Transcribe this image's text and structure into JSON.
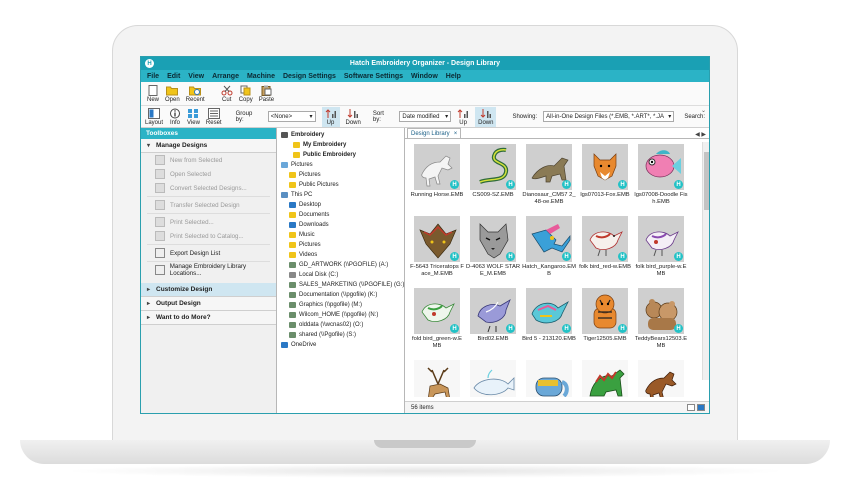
{
  "window": {
    "title": "Hatch Embroidery Organizer - Design Library",
    "app_icon": "H"
  },
  "menu": [
    "File",
    "Edit",
    "View",
    "Arrange",
    "Machine",
    "Design Settings",
    "Software Settings",
    "Window",
    "Help"
  ],
  "toolbar1": [
    {
      "name": "new-button",
      "label": "New",
      "icon": "new-doc-icon"
    },
    {
      "name": "open-button",
      "label": "Open",
      "icon": "folder-open-icon"
    },
    {
      "name": "recent-button",
      "label": "Recent",
      "icon": "recent-folder-icon"
    },
    {
      "name": "cut-button",
      "label": "Cut",
      "icon": "scissors-icon"
    },
    {
      "name": "copy-button",
      "label": "Copy",
      "icon": "copy-icon"
    },
    {
      "name": "paste-button",
      "label": "Paste",
      "icon": "paste-icon"
    }
  ],
  "toolbar2": {
    "layout": "Layout",
    "info": "Info",
    "view": "View",
    "reset": "Reset",
    "group_by_label": "Group by:",
    "group_by_value": "<None>",
    "up1": "Up",
    "down1": "Down",
    "sort_by_label": "Sort by:",
    "sort_by_value": "Date modified",
    "up2": "Up",
    "down2": "Down",
    "showing_label": "Showing:",
    "showing_value": "All-in-One Design Files (*.EMB, *.ART*, *.JA",
    "search_label": "Search:"
  },
  "toolbox": {
    "title": "Toolboxes",
    "manage": "Manage Designs",
    "items": [
      {
        "label": "New from Selected",
        "enabled": false
      },
      {
        "label": "Open Selected",
        "enabled": false
      },
      {
        "label": "Convert Selected Designs...",
        "enabled": false
      },
      {
        "label": "Transfer Selected Design",
        "enabled": false
      },
      {
        "label": "Print Selected...",
        "enabled": false
      },
      {
        "label": "Print Selected to Catalog...",
        "enabled": false
      },
      {
        "label": "Export Design List",
        "enabled": true
      },
      {
        "label": "Manage Embroidery Library Locations...",
        "enabled": true
      }
    ],
    "sections": [
      "Customize Design",
      "Output Design",
      "Want to do More?"
    ]
  },
  "tree": [
    {
      "label": "Embroidery",
      "level": 0,
      "bold": true,
      "color": "#555"
    },
    {
      "label": "My Embroidery",
      "level": 1,
      "bold": true,
      "color": "#f0c419"
    },
    {
      "label": "Public Embroidery",
      "level": 1,
      "bold": true,
      "color": "#f0c419"
    },
    {
      "label": "Pictures",
      "level": 0,
      "bold": false,
      "color": "#6aa7d9"
    },
    {
      "label": "Pictures",
      "level": 1,
      "bold": false,
      "color": "#f0c419"
    },
    {
      "label": "Public Pictures",
      "level": 1,
      "bold": false,
      "color": "#f0c419"
    },
    {
      "label": "This PC",
      "level": 0,
      "bold": false,
      "color": "#5a8fc2"
    },
    {
      "label": "Desktop",
      "level": 1,
      "bold": false,
      "color": "#2a78c5"
    },
    {
      "label": "Documents",
      "level": 1,
      "bold": false,
      "color": "#f0c419"
    },
    {
      "label": "Downloads",
      "level": 1,
      "bold": false,
      "color": "#2a78c5"
    },
    {
      "label": "Music",
      "level": 1,
      "bold": false,
      "color": "#f0c419"
    },
    {
      "label": "Pictures",
      "level": 1,
      "bold": false,
      "color": "#f0c419"
    },
    {
      "label": "Videos",
      "level": 1,
      "bold": false,
      "color": "#f0c419"
    },
    {
      "label": "GD_ARTWORK (\\\\PGOFILE) (A:)",
      "level": 1,
      "bold": false,
      "color": "#6b8e6b"
    },
    {
      "label": "Local Disk (C:)",
      "level": 1,
      "bold": false,
      "color": "#888"
    },
    {
      "label": "SALES_MARKETING (\\\\PGOFILE) (G:)",
      "level": 1,
      "bold": false,
      "color": "#6b8e6b"
    },
    {
      "label": "Documentation (\\\\pgofile) (K:)",
      "level": 1,
      "bold": false,
      "color": "#6b8e6b"
    },
    {
      "label": "Graphics (\\\\pgofile) (M:)",
      "level": 1,
      "bold": false,
      "color": "#6b8e6b"
    },
    {
      "label": "Wilcom_HOME (\\\\pgofile) (N:)",
      "level": 1,
      "bold": false,
      "color": "#6b8e6b"
    },
    {
      "label": "olddata (\\\\wcnas02) (O:)",
      "level": 1,
      "bold": false,
      "color": "#6b8e6b"
    },
    {
      "label": "shared (\\\\Pgofile) (S:)",
      "level": 1,
      "bold": false,
      "color": "#6b8e6b"
    },
    {
      "label": "OneDrive",
      "level": 0,
      "bold": false,
      "color": "#2a78c5"
    }
  ],
  "gallery": {
    "tab": "Design Library",
    "tab_close": "×",
    "status": "56 items",
    "files": [
      {
        "name": "Running Horse.EMB",
        "art": "horse-white"
      },
      {
        "name": "CS009-SZ.EMB",
        "art": "snake"
      },
      {
        "name": "Dianosaur_CM57 2_48-oe.EMB",
        "art": "dino"
      },
      {
        "name": "lgs07013-Fox.EMB",
        "art": "fox"
      },
      {
        "name": "lgs07008-Doodle Fish.EMB",
        "art": "fish"
      },
      {
        "name": "F-5643 Triceratops Face_M.EMB",
        "art": "tri"
      },
      {
        "name": "D-4063 WOLF STARE_M.EMB",
        "art": "wolf"
      },
      {
        "name": "Hatch_Kangaroo.EMB",
        "art": "kanga"
      },
      {
        "name": "folk bird_red-w.EMB",
        "art": "bird-red"
      },
      {
        "name": "folk bird_purple-w.EMB",
        "art": "bird-purple"
      },
      {
        "name": "fold bird_green-w.EMB",
        "art": "bird-green"
      },
      {
        "name": "Bird02.EMB",
        "art": "bird02"
      },
      {
        "name": "Bird 5 - 213120.EMB",
        "art": "bird5"
      },
      {
        "name": "Tiger12505.EMB",
        "art": "tiger"
      },
      {
        "name": "TeddyBears12503.EMB",
        "art": "teddy"
      },
      {
        "name": "",
        "art": "deer"
      },
      {
        "name": "",
        "art": "whale"
      },
      {
        "name": "",
        "art": "elephant"
      },
      {
        "name": "",
        "art": "dino2"
      },
      {
        "name": "",
        "art": "horse-brown"
      }
    ]
  }
}
